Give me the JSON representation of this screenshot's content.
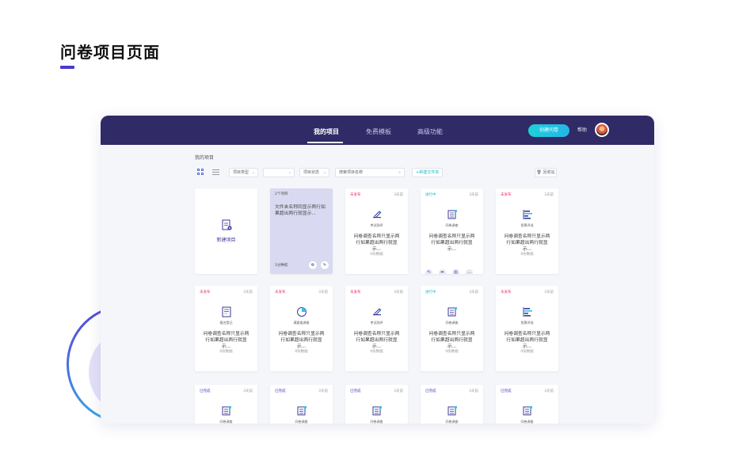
{
  "page": {
    "title": "问卷项目页面",
    "accent": "#4b3ad0"
  },
  "nav": {
    "tabs": [
      {
        "label": "我的项目",
        "active": true
      },
      {
        "label": "免费模板",
        "active": false
      },
      {
        "label": "高级功能",
        "active": false
      }
    ],
    "create_button": "创建问卷",
    "help": "帮助",
    "bar_color": "#302a66"
  },
  "breadcrumb": "我的项目",
  "toolbar": {
    "filter_type": "项目类型",
    "filter_blank": "",
    "filter_status": "项目状态",
    "search_placeholder": "搜索项目名称",
    "new_folder": "+新建文件夹",
    "recycle": "回收站"
  },
  "new_card": {
    "label": "新建项目"
  },
  "folder_card": {
    "count": "2个项目",
    "name": "文件夹名称同显示两行如果超出两行就显示...",
    "time": "1分钟前"
  },
  "status_colors": {
    "未发布": "#e8406c",
    "进行中": "#1eb8c8",
    "已完成": "#4a3fc4"
  },
  "cards": [
    {
      "status": "未发布",
      "days": "3天前",
      "icon": "pen-icon",
      "category": "考试测评",
      "name": "问卷调查名称只显示两行如果超出两行就显示...",
      "count": "0份数据"
    },
    {
      "status": "进行中",
      "days": "3天前",
      "icon": "scroll-icon",
      "category": "问卷调查",
      "name": "问卷调查名称只显示两行如果超出两行就显示...",
      "count": "",
      "actions": true
    },
    {
      "status": "未发布",
      "days": "3天前",
      "icon": "chart-bars-icon",
      "category": "投票评选",
      "name": "问卷调查名称只显示两行如果超出两行就显示...",
      "count": "0份数据"
    },
    {
      "status": "未发布",
      "days": "3天前",
      "icon": "doc-icon",
      "category": "报名登记",
      "name": "问卷调查名称只显示两行如果超出两行就显示...",
      "count": "0份数据"
    },
    {
      "status": "未发布",
      "days": "3天前",
      "icon": "pie-icon",
      "category": "满意度调查",
      "name": "问卷调查名称只显示两行如果超出两行就显示...",
      "count": "0份数据"
    },
    {
      "status": "未发布",
      "days": "3天前",
      "icon": "pen-icon",
      "category": "考试测评",
      "name": "问卷调查名称只显示两行如果超出两行就显示...",
      "count": "0份数据"
    },
    {
      "status": "进行中",
      "days": "3天前",
      "icon": "scroll-icon",
      "category": "问卷调查",
      "name": "问卷调查名称只显示两行如果超出两行就显示...",
      "count": "0份数据"
    },
    {
      "status": "未发布",
      "days": "3天前",
      "icon": "chart-bars-icon",
      "category": "投票评选",
      "name": "问卷调查名称只显示两行如果超出两行就显示...",
      "count": "0份数据"
    },
    {
      "status": "已完成",
      "days": "3天前",
      "icon": "scroll-icon",
      "category": "问卷调查",
      "name": "",
      "count": ""
    },
    {
      "status": "已完成",
      "days": "3天前",
      "icon": "scroll-icon",
      "category": "问卷调查",
      "name": "",
      "count": ""
    },
    {
      "status": "已完成",
      "days": "3天前",
      "icon": "scroll-icon",
      "category": "问卷调查",
      "name": "",
      "count": ""
    },
    {
      "status": "已完成",
      "days": "3天前",
      "icon": "scroll-icon",
      "category": "问卷调查",
      "name": "",
      "count": ""
    },
    {
      "status": "已完成",
      "days": "3天前",
      "icon": "scroll-icon",
      "category": "问卷调查",
      "name": "",
      "count": ""
    }
  ]
}
